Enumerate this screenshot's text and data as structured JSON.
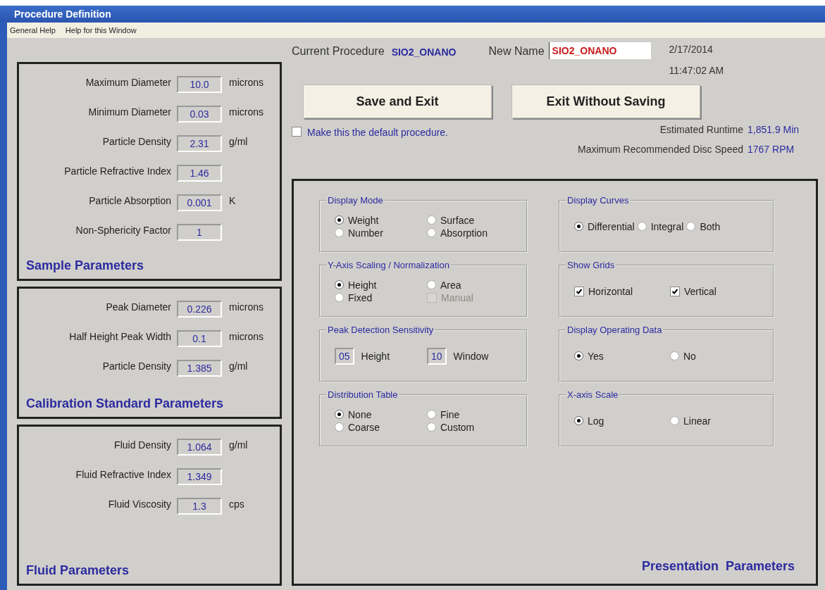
{
  "window": {
    "title": "Procedure Definition"
  },
  "menu": [
    "General Help",
    "Help for this Window"
  ],
  "header": {
    "current_label": "Current Procedure",
    "current_value": "SIO2_ONANO",
    "new_name_label": "New Name",
    "new_name_value": "SIO2_ONANO",
    "date": "2/17/2014",
    "time": "11:47:02 AM"
  },
  "buttons": [
    "Save and Exit",
    "Exit Without Saving"
  ],
  "default_checkbox": {
    "label": "Make this the default procedure.",
    "checked": false
  },
  "stats": [
    {
      "label": "Estimated Runtime",
      "value": "1,851.9 Min"
    },
    {
      "label": "Maximum Recommended Disc Speed",
      "value": "1767 RPM"
    }
  ],
  "left_panels": [
    {
      "title": "Sample Parameters",
      "fields": [
        {
          "label": "Maximum Diameter",
          "value": "10.0",
          "unit": "microns"
        },
        {
          "label": "Minimum Diameter",
          "value": "0.03",
          "unit": "microns"
        },
        {
          "label": "Particle Density",
          "value": "2.31",
          "unit": "g/ml"
        },
        {
          "label": "Particle Refractive Index",
          "value": "1.46"
        },
        {
          "label": "Particle Absorption",
          "value": "0.001",
          "unit": "K"
        },
        {
          "label": "Non-Sphericity Factor",
          "value": "1"
        }
      ]
    },
    {
      "title": "Calibration Standard Parameters",
      "fields": [
        {
          "label": "Peak Diameter",
          "value": "0.226",
          "unit": "microns"
        },
        {
          "label": "Half Height Peak Width",
          "value": "0.1",
          "unit": "microns"
        },
        {
          "label": "Particle Density",
          "value": "1.385",
          "unit": "g/ml"
        }
      ]
    },
    {
      "title": "Fluid Parameters",
      "fields": [
        {
          "label": "Fluid Density",
          "value": "1.064",
          "unit": "g/ml"
        },
        {
          "label": "Fluid Refractive Index",
          "value": "1.349"
        },
        {
          "label": "Fluid Viscosity",
          "value": "1.3",
          "unit": "cps"
        }
      ]
    }
  ],
  "presentation": {
    "title": "Presentation  Parameters",
    "groups": [
      {
        "title": "Display Mode",
        "rows": [
          [
            {
              "kind": "radio",
              "label": "Weight",
              "selected": true
            },
            {
              "kind": "radio",
              "label": "Surface",
              "selected": false
            }
          ],
          [
            {
              "kind": "radio",
              "label": "Number",
              "selected": false
            },
            {
              "kind": "radio",
              "label": "Absorption",
              "selected": false
            }
          ]
        ]
      },
      {
        "title": "Display Curves",
        "rows": [
          [
            {
              "kind": "radio",
              "label": "Differential",
              "selected": true
            },
            {
              "kind": "radio",
              "label": "Integral",
              "selected": false
            },
            {
              "kind": "radio",
              "label": "Both",
              "selected": false
            }
          ]
        ]
      },
      {
        "title": "Y-Axis Scaling / Normalization",
        "rows": [
          [
            {
              "kind": "radio",
              "label": "Height",
              "selected": true
            },
            {
              "kind": "radio",
              "label": "Area",
              "selected": false
            }
          ],
          [
            {
              "kind": "radio",
              "label": "Fixed",
              "selected": false
            },
            {
              "kind": "checkbox",
              "label": "Manual",
              "checked": false,
              "disabled": true
            }
          ]
        ]
      },
      {
        "title": "Show Grids",
        "rows": [
          [
            {
              "kind": "checkbox",
              "label": "Horizontal",
              "checked": true,
              "disabled": false
            },
            {
              "kind": "checkbox",
              "label": "Vertical",
              "checked": true,
              "disabled": false
            }
          ]
        ]
      },
      {
        "title": "Peak Detection Sensitivity",
        "rows": [
          [
            {
              "kind": "input",
              "value": "05",
              "label": "Height"
            },
            {
              "kind": "input",
              "value": "10",
              "label": "Window"
            }
          ]
        ]
      },
      {
        "title": "Display Operating Data",
        "rows": [
          [
            {
              "kind": "radio",
              "label": "Yes",
              "selected": true
            },
            {
              "kind": "radio",
              "label": "No",
              "selected": false
            }
          ]
        ]
      },
      {
        "title": "Distribution Table",
        "rows": [
          [
            {
              "kind": "radio",
              "label": "None",
              "selected": true
            },
            {
              "kind": "radio",
              "label": "Fine",
              "selected": false
            }
          ],
          [
            {
              "kind": "radio",
              "label": "Coarse",
              "selected": false
            },
            {
              "kind": "radio",
              "label": "Custom",
              "selected": false
            }
          ]
        ]
      },
      {
        "title": "X-axis Scale",
        "rows": [
          [
            {
              "kind": "radio",
              "label": "Log",
              "selected": true
            },
            {
              "kind": "radio",
              "label": "Linear",
              "selected": false
            }
          ]
        ]
      }
    ]
  }
}
